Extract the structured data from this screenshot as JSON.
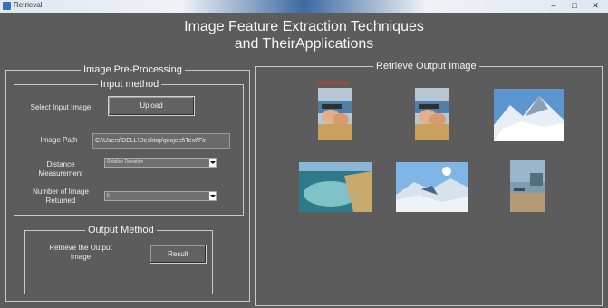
{
  "window": {
    "title": "Retrieval",
    "controls": [
      "–",
      "□",
      "✕"
    ]
  },
  "header": {
    "title_line1": "Image Feature Extraction Techniques",
    "title_line2": "and TheirApplications"
  },
  "preprocessing": {
    "title": "Image Pre-Processing",
    "input_method": {
      "title": "Input method",
      "select_image_label": "Select Input Image",
      "upload_button": "Upload",
      "image_path_label": "Image Path",
      "image_path_value": "C:\\Users\\DELL\\Desktop\\project\\Text\\Fir",
      "distance_label": "Distance Measurement",
      "distance_value": "Relative Deviation",
      "num_images_label": "Number of Image Returned",
      "num_images_value": "6"
    },
    "output_method": {
      "title": "Output Method",
      "retrieve_label": "Retrieve the Output Image",
      "result_button": "Result"
    }
  },
  "output": {
    "title": "Retrieve Output Image",
    "query_label": "Query Image",
    "images": [
      {
        "name": "query-image",
        "scene": "kids on beach",
        "colors": [
          "#b9c6d4",
          "#4f7fa8",
          "#e2b089",
          "#c8a25a"
        ]
      },
      {
        "name": "result-image-1",
        "scene": "kids on beach",
        "colors": [
          "#b9c6d4",
          "#4f7fa8",
          "#e2b089",
          "#c8a25a"
        ]
      },
      {
        "name": "result-image-2",
        "scene": "snow mountain",
        "colors": [
          "#5d95cf",
          "#e8eef5",
          "#8aa0b4",
          "#ffffff"
        ]
      },
      {
        "name": "result-image-3",
        "scene": "coastal lagoon",
        "colors": [
          "#6fa3c2",
          "#2f7a8a",
          "#7fc3c6",
          "#c8a96e"
        ]
      },
      {
        "name": "result-image-4",
        "scene": "snowy valley",
        "colors": [
          "#7fb6e6",
          "#eef3f8",
          "#4b6480",
          "#d8e2ec"
        ]
      },
      {
        "name": "result-image-5",
        "scene": "seaside harbor",
        "colors": [
          "#9ab6cc",
          "#546e82",
          "#7f9caf",
          "#b49a72"
        ]
      }
    ]
  }
}
